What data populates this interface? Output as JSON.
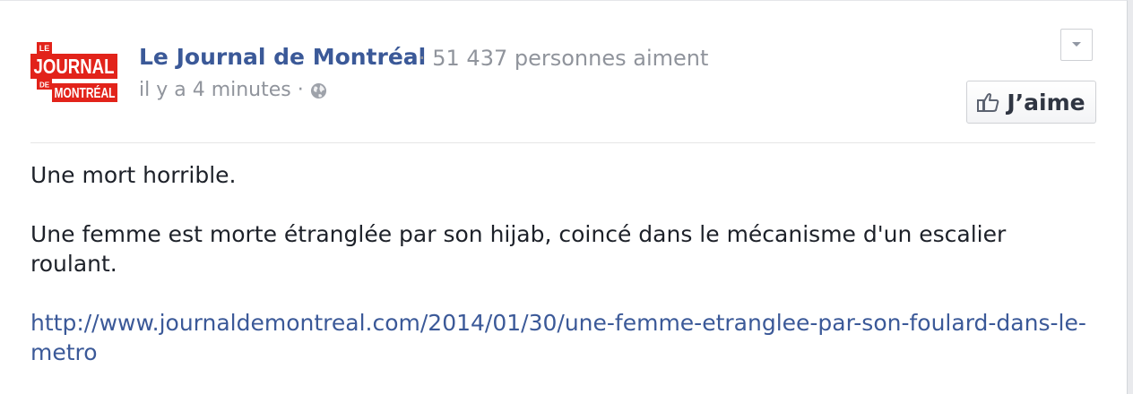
{
  "post": {
    "page_name": "Le Journal de Montréal",
    "likes_text": "· 51 437 personnes aiment",
    "timestamp": "il y a 4 minutes",
    "separator": "·",
    "like_button_label": "J’aime",
    "message": {
      "line1": "Une mort horrible.",
      "line2": "Une femme est morte étranglée par son hijab, coincé dans le mécanisme d'un escalier roulant.",
      "link_text": "http://www.journaldemontreal.com/2014/01/30/une-femme-etranglee-par-son-foulard-dans-le-metro"
    }
  },
  "logo": {
    "top": "LE",
    "middle": "JOURNAL",
    "small": "DE",
    "bottom": "MONTRÉAL",
    "color": "#e2231a"
  },
  "icons": {
    "audience": "globe-icon",
    "menu": "chevron-down-icon",
    "like": "thumbs-up-icon"
  },
  "colors": {
    "link": "#3b5998",
    "meta": "#90949c",
    "text": "#1d2129"
  }
}
